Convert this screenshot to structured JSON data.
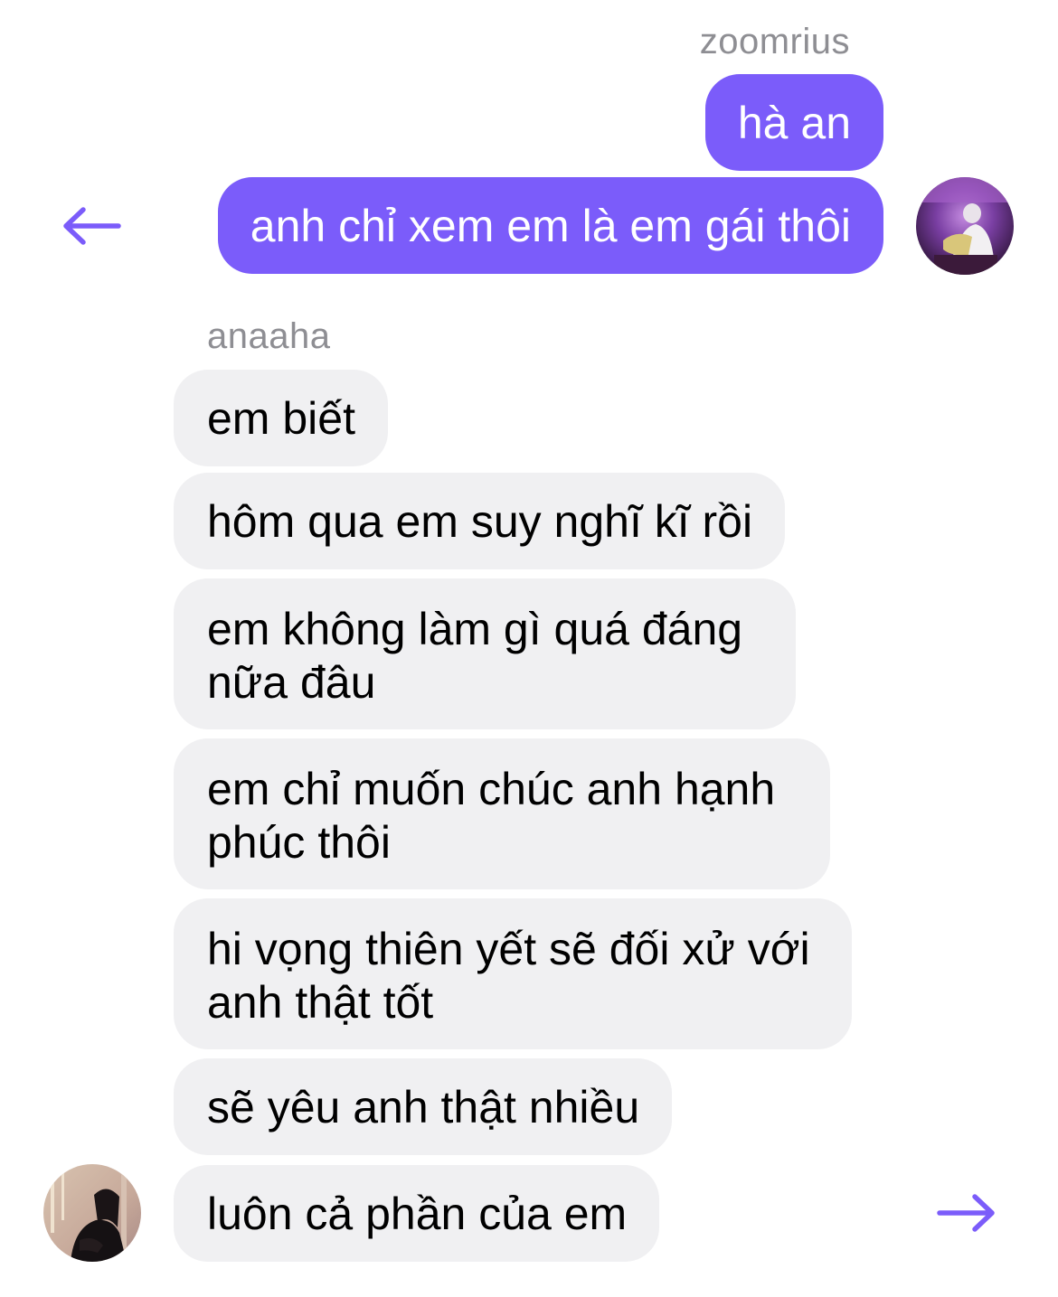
{
  "thread": {
    "outgoing_sender": "zoomrius",
    "outgoing_messages": [
      "hà an",
      "anh chỉ xem em là em gái thôi"
    ],
    "incoming_sender": "anaaha",
    "incoming_messages": [
      "em biết",
      "hôm qua em suy nghĩ kĩ rồi",
      "em không làm gì quá đáng\nnữa đâu",
      "em chỉ muốn chúc anh hạnh\nphúc thôi",
      "hi vọng thiên yết sẽ đối xử với\nanh thật tốt",
      "sẽ yêu anh thật nhiều",
      "luôn cả phần của em"
    ]
  },
  "icons": {
    "back": "arrow-left-icon",
    "forward": "arrow-right-icon"
  },
  "colors": {
    "accent": "#7b5cfa",
    "incoming_bubble": "#f0f0f2",
    "sender_name": "#8e8e93"
  }
}
